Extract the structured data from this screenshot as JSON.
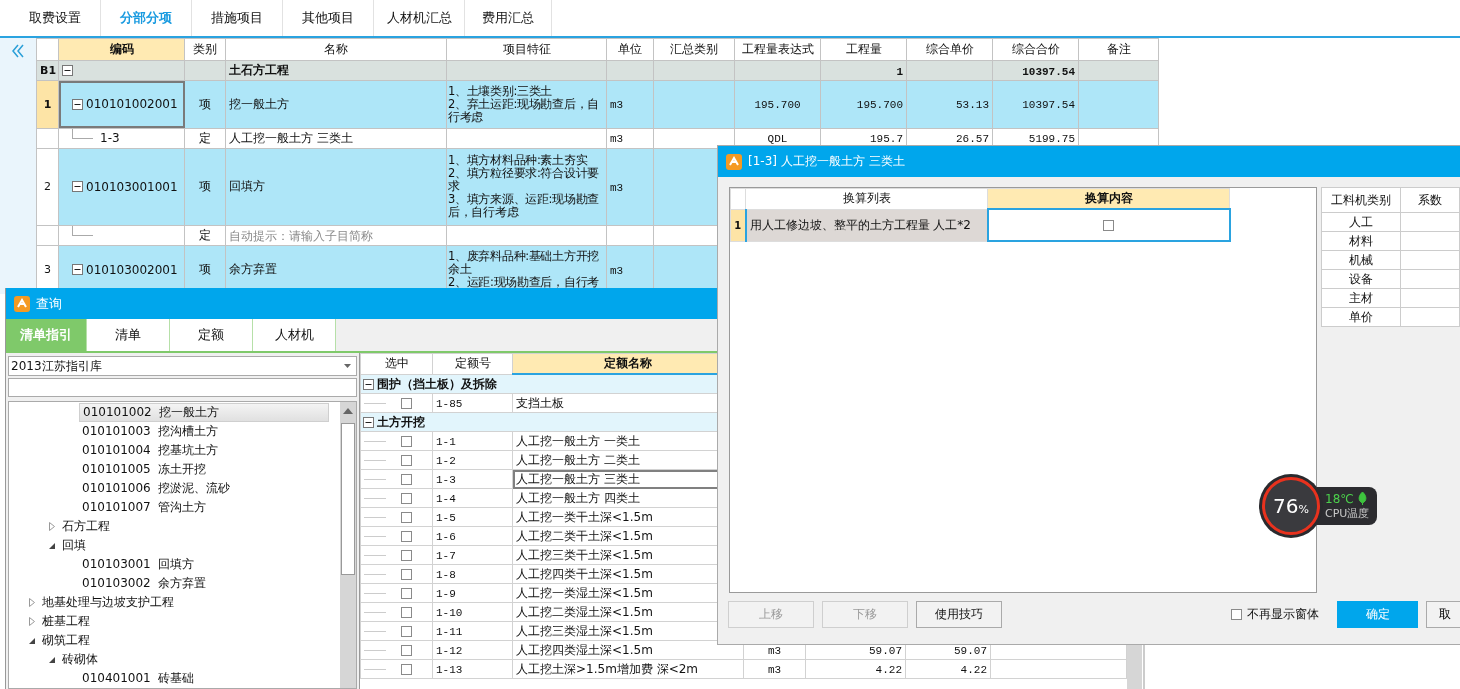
{
  "tabs": [
    {
      "label": "取费设置",
      "selected": false
    },
    {
      "label": "分部分项",
      "selected": true
    },
    {
      "label": "措施项目",
      "selected": false
    },
    {
      "label": "其他项目",
      "selected": false
    },
    {
      "label": "人材机汇总",
      "selected": false
    },
    {
      "label": "费用汇总",
      "selected": false
    }
  ],
  "table": {
    "columns": [
      {
        "label": "编码",
        "highlighted": true
      },
      {
        "label": "类别",
        "highlighted": false
      },
      {
        "label": "名称",
        "highlighted": false
      },
      {
        "label": "项目特征",
        "highlighted": false
      },
      {
        "label": "单位",
        "highlighted": false
      },
      {
        "label": "汇总类别",
        "highlighted": false
      },
      {
        "label": "工程量表达式",
        "highlighted": false
      },
      {
        "label": "工程量",
        "highlighted": false
      },
      {
        "label": "综合单价",
        "highlighted": false
      },
      {
        "label": "综合合价",
        "highlighted": false
      },
      {
        "label": "备注",
        "highlighted": false
      }
    ],
    "rows": [
      {
        "kind": "group",
        "num": "B1",
        "expanded": true,
        "name": "土石方工程",
        "qty": "1",
        "total": "10397.54"
      },
      {
        "kind": "item",
        "num": "1",
        "selected": true,
        "expanded": true,
        "code": "010101002001",
        "type": "项",
        "name": "挖一般土方",
        "features": [
          "1、土壤类别:三类土",
          "2、弃土运距:现场勘查后，自行考虑"
        ],
        "unit": "m3",
        "expr": "195.700",
        "qty": "195.700",
        "price": "53.13",
        "total": "10397.54"
      },
      {
        "kind": "sub",
        "code": "1-3",
        "type": "定",
        "name": "人工挖一般土方 三类土",
        "unit": "m3",
        "expr": "QDL",
        "qty": "195.7",
        "price": "26.57",
        "total": "5199.75"
      },
      {
        "kind": "item",
        "num": "2",
        "selected": false,
        "expanded": true,
        "code": "010103001001",
        "type": "项",
        "name": "回填方",
        "features": [
          "1、填方材料品种:素土夯实",
          "2、填方粒径要求:符合设计要求",
          "3、填方来源、运距:现场勘查后，自行考虑"
        ],
        "unit": "m3"
      },
      {
        "kind": "sub",
        "type": "定",
        "placeholder": "自动提示：请输入子目简称"
      },
      {
        "kind": "item",
        "num": "3",
        "selected": false,
        "expanded": true,
        "code": "010103002001",
        "type": "项",
        "name": "余方弃置",
        "features": [
          "1、废弃料品种:基础土方开挖余土",
          "2、运距:现场勘查后，自行考"
        ],
        "unit": "m3"
      }
    ]
  },
  "query": {
    "title": "查询",
    "tabs": [
      {
        "label": "清单指引",
        "selected": true
      },
      {
        "label": "清单",
        "selected": false
      },
      {
        "label": "定额",
        "selected": false
      },
      {
        "label": "人材机",
        "selected": false
      }
    ],
    "library": "2013江苏指引库",
    "tree": [
      {
        "children": [
          {
            "children": [
              {
                "code": "010101002",
                "name": "挖一般土方",
                "selected": true
              },
              {
                "code": "010101003",
                "name": "挖沟槽土方",
                "selected": false
              },
              {
                "code": "010101004",
                "name": "挖基坑土方",
                "selected": false
              },
              {
                "code": "010101005",
                "name": "冻土开挖",
                "selected": false
              },
              {
                "code": "010101006",
                "name": "挖淤泥、流砂",
                "selected": false
              },
              {
                "code": "010101007",
                "name": "管沟土方",
                "selected": false
              }
            ]
          },
          {
            "name": "石方工程",
            "expanded": false,
            "selected": false
          },
          {
            "name": "回填",
            "expanded": true,
            "selected": false,
            "children": [
              {
                "code": "010103001",
                "name": "回填方",
                "selected": false
              },
              {
                "code": "010103002",
                "name": "余方弃置",
                "selected": false
              }
            ]
          }
        ]
      },
      {
        "name": "地基处理与边坡支护工程",
        "expanded": false,
        "selected": false
      },
      {
        "name": "桩基工程",
        "expanded": false,
        "selected": false
      },
      {
        "name": "砌筑工程",
        "expanded": true,
        "selected": false,
        "children": [
          {
            "name": "砖砌体",
            "expanded": true,
            "selected": false,
            "children": [
              {
                "code": "010401001",
                "name": "砖基础",
                "selected": false
              }
            ]
          }
        ]
      }
    ],
    "grid": {
      "columns": [
        {
          "label": "选中",
          "highlighted": false
        },
        {
          "label": "定额号",
          "highlighted": false
        },
        {
          "label": "定额名称",
          "highlighted": true
        }
      ],
      "groups": [
        {
          "name": "围护（挡土板）及拆除",
          "expanded": true,
          "rows": [
            {
              "code": "1-85",
              "name": "支挡土板",
              "checked": false,
              "selected": false
            }
          ]
        },
        {
          "name": "土方开挖",
          "expanded": true,
          "rows": [
            {
              "code": "1-1",
              "name": "人工挖一般土方 一类土",
              "checked": false,
              "selected": false
            },
            {
              "code": "1-2",
              "name": "人工挖一般土方 二类土",
              "checked": false,
              "selected": false
            },
            {
              "code": "1-3",
              "name": "人工挖一般土方 三类土",
              "checked": false,
              "selected": true
            },
            {
              "code": "1-4",
              "name": "人工挖一般土方 四类土",
              "checked": false,
              "selected": false
            },
            {
              "code": "1-5",
              "name": "人工挖一类干土深<1.5m",
              "checked": false,
              "selected": false
            },
            {
              "code": "1-6",
              "name": "人工挖二类干土深<1.5m",
              "checked": false,
              "selected": false
            },
            {
              "code": "1-7",
              "name": "人工挖三类干土深<1.5m",
              "checked": false,
              "selected": false
            },
            {
              "code": "1-8",
              "name": "人工挖四类干土深<1.5m",
              "checked": false,
              "selected": false
            },
            {
              "code": "1-9",
              "name": "人工挖一类湿土深<1.5m",
              "checked": false,
              "selected": false
            },
            {
              "code": "1-10",
              "name": "人工挖二类湿土深<1.5m",
              "checked": false,
              "selected": false
            },
            {
              "code": "1-11",
              "name": "人工挖三类湿土深<1.5m",
              "checked": false,
              "selected": false
            },
            {
              "code": "1-12",
              "name": "人工挖四类湿土深<1.5m",
              "checked": false,
              "selected": false,
              "unit": "m3",
              "column_5": "59.07",
              "column_6": "59.07"
            },
            {
              "code": "1-13",
              "name": "人工挖土深>1.5m增加费 深<2m",
              "checked": false,
              "selected": false,
              "unit": "m3",
              "column_5": "4.22",
              "column_6": "4.22"
            }
          ]
        }
      ]
    }
  },
  "dialog": {
    "title": "[1-3] 人工挖一般土方 三类土",
    "columns": [
      {
        "label": "换算列表",
        "highlighted": false
      },
      {
        "label": "换算内容",
        "highlighted": true
      }
    ],
    "rows": [
      {
        "num": "1",
        "text": "用人工修边坡、整平的土方工程量 人工*2",
        "checked": false
      }
    ],
    "factors": {
      "columns": [
        "工料机类别",
        "系数"
      ],
      "rows": [
        "人工",
        "材料",
        "机械",
        "设备",
        "主材",
        "单价"
      ]
    },
    "buttons": [
      {
        "label": "上移",
        "disabled": true
      },
      {
        "label": "下移",
        "disabled": true
      },
      {
        "label": "使用技巧",
        "disabled": false
      }
    ],
    "dont_show": {
      "label": "不再显示窗体",
      "checked": false
    },
    "actions": [
      {
        "label": "确定",
        "kind": "primary"
      },
      {
        "label": "取",
        "kind": "plain"
      }
    ]
  },
  "cpu": {
    "percent": "76",
    "unit": "%",
    "temp": "18℃",
    "label": "CPU温度"
  }
}
